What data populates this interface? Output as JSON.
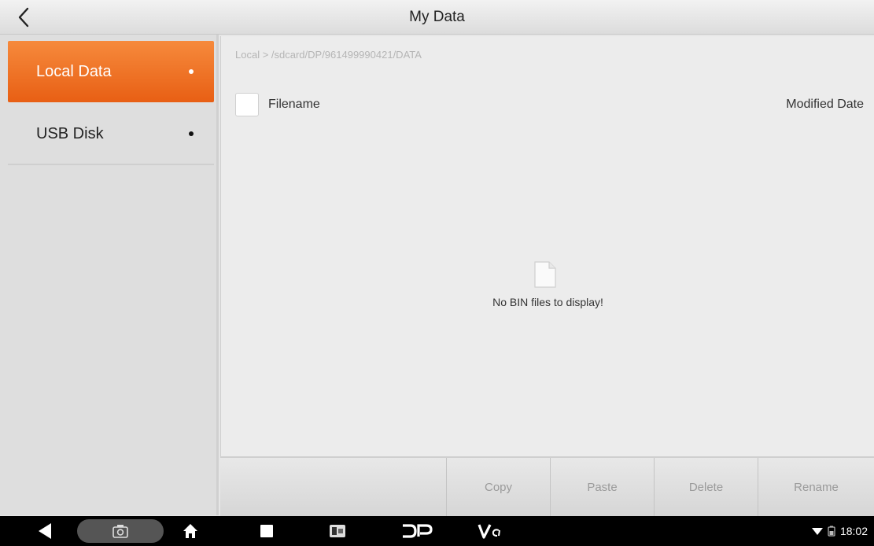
{
  "window": {
    "title": "My Data"
  },
  "sidebar": {
    "items": [
      {
        "label": "Local Data",
        "active": true
      },
      {
        "label": "USB Disk",
        "active": false
      }
    ]
  },
  "main": {
    "path": "Local > /sdcard/DP/961499990421/DATA",
    "columns": {
      "filename": "Filename",
      "modified": "Modified Date"
    },
    "empty_message": "No BIN files to display!"
  },
  "actions": {
    "copy": "Copy",
    "paste": "Paste",
    "delete": "Delete",
    "rename": "Rename"
  },
  "status_bar": {
    "time": "18:02"
  },
  "nav_icons": [
    "back-icon",
    "screenshot-icon",
    "home-icon",
    "recent-apps-icon",
    "app-shortcut-icon",
    "dp-logo",
    "vci-logo"
  ],
  "colors": {
    "accent": "#ee6f20",
    "navbar": "#000000"
  }
}
